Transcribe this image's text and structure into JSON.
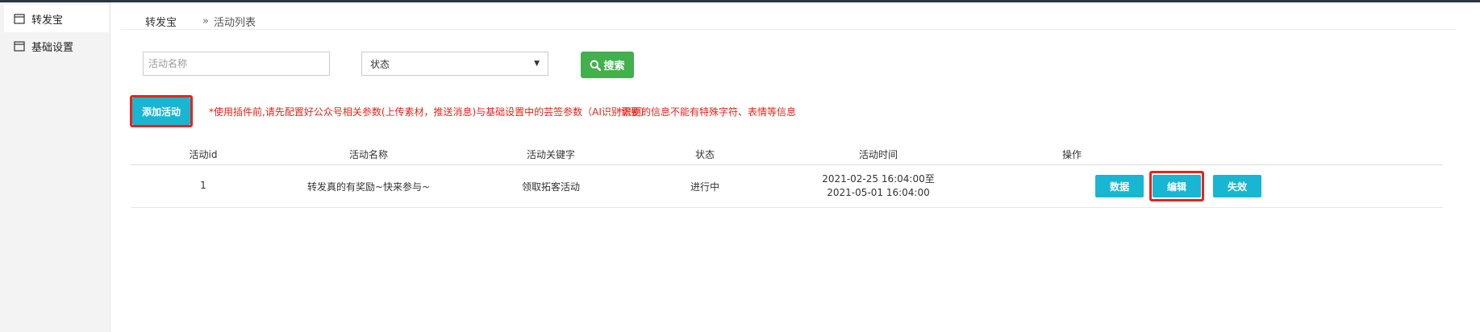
{
  "sidebar": {
    "items": [
      {
        "label": "转发宝",
        "icon": "calendar-icon"
      },
      {
        "label": "基础设置",
        "icon": "calendar-icon"
      }
    ]
  },
  "breadcrumb": {
    "root": "转发宝",
    "separator": "»",
    "current": "活动列表"
  },
  "filters": {
    "name_placeholder": "活动名称",
    "status_value": "状态",
    "search_label": "搜索"
  },
  "actions": {
    "add_label": "添加活动"
  },
  "notices": {
    "notice1": "*使用插件前,请先配置好公众号相关参数(上传素材，推送消息)与基础设置中的芸签参数（AI识别需要）",
    "notice2": "*识别的信息不能有特殊字符、表情等信息"
  },
  "table": {
    "headers": [
      "活动id",
      "活动名称",
      "活动关键字",
      "状态",
      "活动时间",
      "操作"
    ],
    "rows": [
      {
        "id": "1",
        "name": "转发真的有奖励~快来参与~",
        "keyword": "领取拓客活动",
        "status": "进行中",
        "time_start": "2021-02-25 16:04:00至",
        "time_end": "2021-05-01 16:04:00",
        "buttons": {
          "data": "数据",
          "edit": "编辑",
          "disable": "失效"
        }
      }
    ]
  },
  "colors": {
    "accent": "#18b6d2",
    "search": "#42b04c",
    "notice": "#e8231a",
    "highlight": "#e8231a",
    "sidebar_bg": "#f3f3f3"
  }
}
